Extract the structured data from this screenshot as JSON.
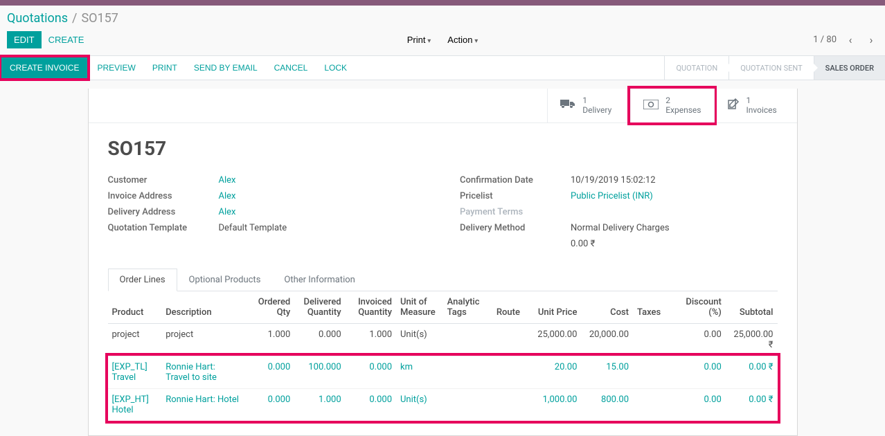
{
  "breadcrumb": {
    "parent": "Quotations",
    "sep": "/",
    "current": "SO157"
  },
  "controls": {
    "edit": "EDIT",
    "create": "CREATE",
    "print": "Print",
    "action": "Action"
  },
  "pager": {
    "text": "1 / 80"
  },
  "statusbar": {
    "create_invoice": "CREATE INVOICE",
    "preview": "PREVIEW",
    "print": "PRINT",
    "send_email": "SEND BY EMAIL",
    "cancel": "CANCEL",
    "lock": "LOCK",
    "steps": {
      "quotation": "QUOTATION",
      "quotation_sent": "QUOTATION SENT",
      "sales_order": "SALES ORDER"
    }
  },
  "stats": {
    "delivery": {
      "count": "1",
      "label": "Delivery"
    },
    "expenses": {
      "count": "2",
      "label": "Expenses"
    },
    "invoices": {
      "count": "1",
      "label": "Invoices"
    }
  },
  "title": "SO157",
  "left": {
    "customer_label": "Customer",
    "customer": "Alex",
    "invoice_addr_label": "Invoice Address",
    "invoice_addr": "Alex",
    "delivery_addr_label": "Delivery Address",
    "delivery_addr": "Alex",
    "qt_template_label": "Quotation Template",
    "qt_template": "Default Template"
  },
  "right": {
    "conf_label": "Confirmation Date",
    "conf": "10/19/2019 15:02:12",
    "pricelist_label": "Pricelist",
    "pricelist": "Public Pricelist (INR)",
    "payment_terms_label": "Payment Terms",
    "payment_terms": "",
    "delivery_method_label": "Delivery Method",
    "delivery_method": "Normal Delivery Charges",
    "delivery_cost": "0.00 ₹"
  },
  "tabs": {
    "order_lines": "Order Lines",
    "optional": "Optional Products",
    "other": "Other Information"
  },
  "head": {
    "product": "Product",
    "desc": "Description",
    "ordqty": "Ordered Qty",
    "delqty": "Delivered Quantity",
    "invqty": "Invoiced Quantity",
    "uom": "Unit of Measure",
    "tags": "Analytic Tags",
    "route": "Route",
    "unitprice": "Unit Price",
    "cost": "Cost",
    "taxes": "Taxes",
    "discount": "Discount (%)",
    "subtotal": "Subtotal"
  },
  "lines": [
    {
      "product": "project",
      "desc": "project",
      "ordqty": "1.000",
      "delqty": "0.000",
      "invqty": "1.000",
      "uom": "Unit(s)",
      "tags": "",
      "route": "",
      "unitprice": "25,000.00",
      "cost": "20,000.00",
      "taxes": "",
      "discount": "0.00",
      "subtotal": "25,000.00 ₹",
      "link": false
    },
    {
      "product": "[EXP_TL] Travel",
      "desc": "Ronnie Hart: Travel to site",
      "ordqty": "0.000",
      "delqty": "100.000",
      "invqty": "0.000",
      "uom": "km",
      "tags": "",
      "route": "",
      "unitprice": "20.00",
      "cost": "15.00",
      "taxes": "",
      "discount": "0.00",
      "subtotal": "0.00 ₹",
      "link": true
    },
    {
      "product": "[EXP_HT] Hotel",
      "desc": "Ronnie Hart: Hotel",
      "ordqty": "0.000",
      "delqty": "1.000",
      "invqty": "0.000",
      "uom": "Unit(s)",
      "tags": "",
      "route": "",
      "unitprice": "1,000.00",
      "cost": "800.00",
      "taxes": "",
      "discount": "0.00",
      "subtotal": "0.00 ₹",
      "link": true
    }
  ]
}
